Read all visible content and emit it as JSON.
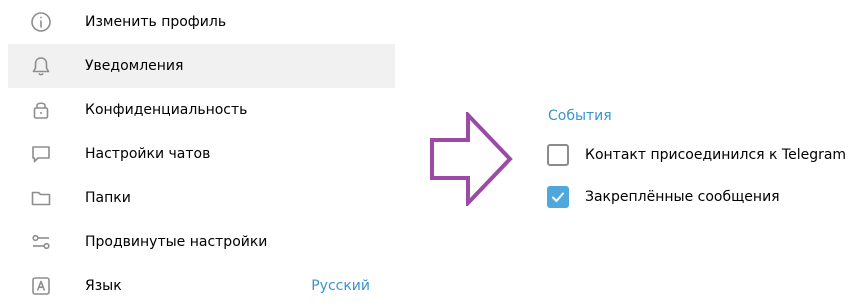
{
  "menu": {
    "items": [
      {
        "label": "Изменить профиль",
        "icon": "info-icon"
      },
      {
        "label": "Уведомления",
        "icon": "bell-icon",
        "active": true
      },
      {
        "label": "Конфиденциальность",
        "icon": "lock-icon"
      },
      {
        "label": "Настройки чатов",
        "icon": "chat-bubble-icon"
      },
      {
        "label": "Папки",
        "icon": "folder-icon"
      },
      {
        "label": "Продвинутые настройки",
        "icon": "sliders-icon"
      },
      {
        "label": "Язык",
        "icon": "language-icon",
        "value": "Русский"
      }
    ]
  },
  "events": {
    "title": "События",
    "options": [
      {
        "label": "Контакт присоединился к Telegram",
        "checked": false
      },
      {
        "label": "Закреплённые сообщения",
        "checked": true
      }
    ]
  },
  "colors": {
    "accent": "#3a95c9",
    "checkbox_checked": "#4fa8dc",
    "active_row": "#f1f1f1",
    "arrow": "#9b4aa6",
    "icon": "#8e8e8e"
  }
}
